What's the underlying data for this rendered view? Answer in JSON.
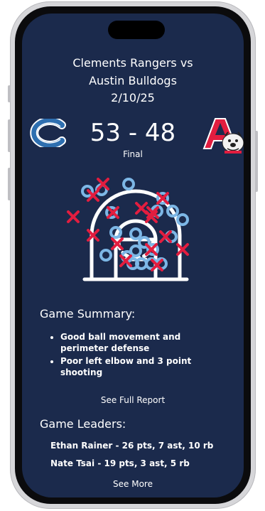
{
  "game": {
    "title_line1": "Clements Rangers vs",
    "title_line2": "Austin Bulldogs",
    "date": "2/10/25",
    "score": "53 - 48",
    "status": "Final",
    "home_logo_icon": "clements-c-logo",
    "away_logo_icon": "austin-a-bulldog-logo"
  },
  "summary": {
    "title": "Game Summary:",
    "items": [
      "Good ball movement and perimeter defense",
      "Poor left elbow and 3 point shooting"
    ],
    "link": "See Full Report"
  },
  "leaders": {
    "title": "Game Leaders:",
    "items": [
      "Ethan Rainer - 26 pts, 7 ast, 10 rb",
      "Nate Tsai - 19 pts, 3 ast, 5 rb"
    ],
    "link": "See More"
  },
  "colors": {
    "screen_bg": "#1b2a4c",
    "made_shot": "#7db7e6",
    "missed_shot": "#e21d3f",
    "text": "#ffffff"
  }
}
